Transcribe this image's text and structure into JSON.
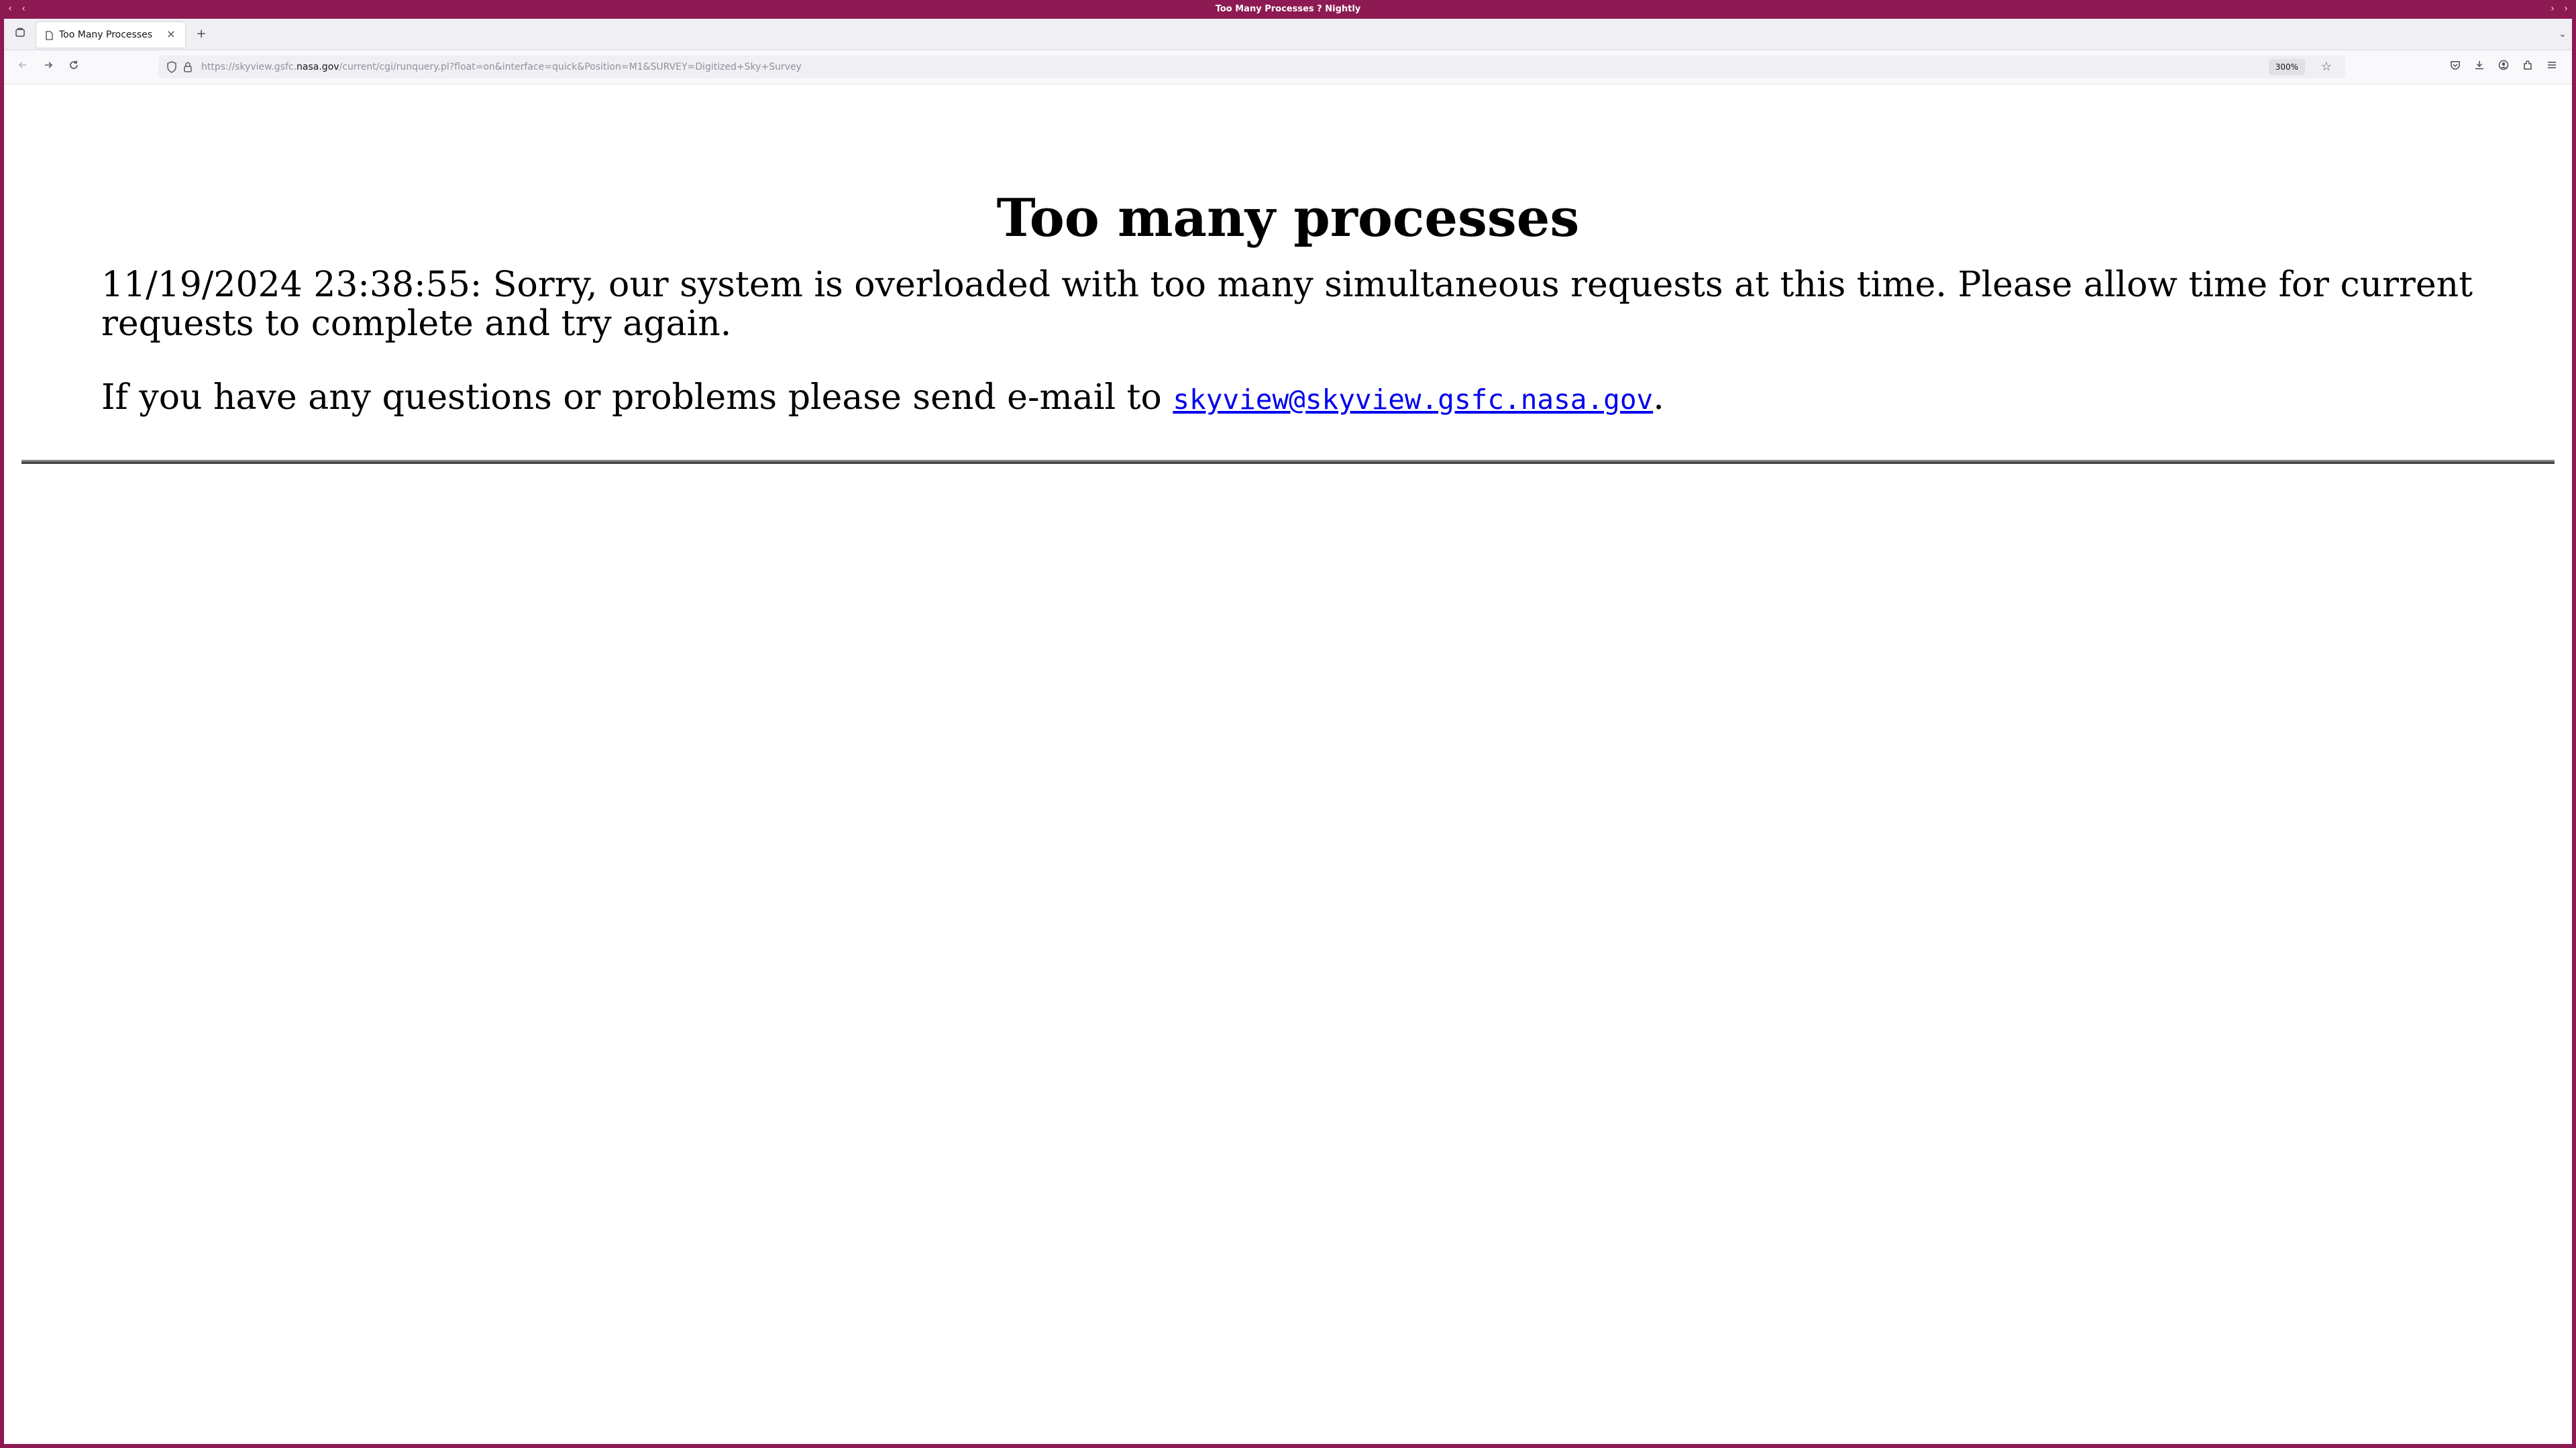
{
  "window": {
    "title": "Too Many Processes ? Nightly"
  },
  "tabs": [
    {
      "label": "Too Many Processes",
      "active": true
    }
  ],
  "navbar": {
    "url_prefix": "https://skyview.gsfc.",
    "url_domain": "nasa.gov",
    "url_suffix": "/current/cgi/runquery.pl?float=on&interface=quick&Position=M1&SURVEY=Digitized+Sky+Survey",
    "zoom": "300%"
  },
  "page": {
    "heading": "Too many processes",
    "message": "11/19/2024 23:38:55: Sorry, our system is overloaded with too many simultaneous requests at this time. Please allow time for current requests to complete and try again.",
    "contact_prefix": "If you have any questions or problems please send e-mail to ",
    "contact_email": "skyview@skyview.gsfc.nasa.gov",
    "contact_suffix": "."
  },
  "colors": {
    "titlebar": "#8d1a52",
    "link": "#0000ee"
  },
  "icons": [
    "tab-overview-icon",
    "page-icon",
    "close-icon",
    "plus-icon",
    "chevron-down-icon",
    "back-icon",
    "forward-icon",
    "reload-icon",
    "shield-icon",
    "lock-icon",
    "star-icon",
    "pocket-icon",
    "download-icon",
    "account-icon",
    "extensions-icon",
    "menu-icon"
  ]
}
